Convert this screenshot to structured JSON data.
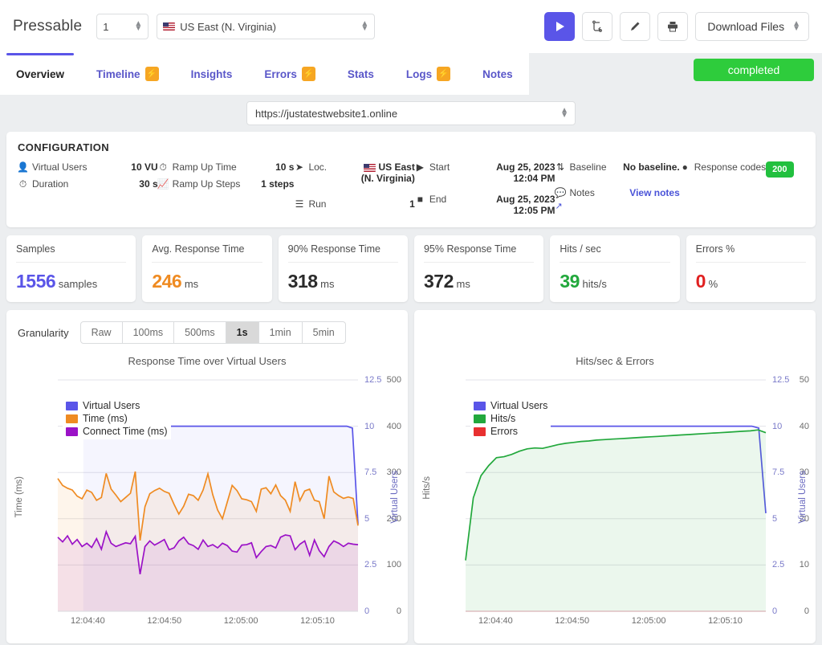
{
  "topbar": {
    "brand": "Pressable",
    "run_number": "1",
    "region": "US East (N. Virginia)",
    "play_icon": "play-icon",
    "compare_icon": "compare-icon",
    "edit_icon": "pencil-icon",
    "print_icon": "printer-icon",
    "download_label": "Download Files"
  },
  "tabs": [
    {
      "label": "Overview",
      "badge": "",
      "active": true
    },
    {
      "label": "Timeline",
      "badge": "⚡",
      "active": false
    },
    {
      "label": "Insights",
      "badge": "",
      "active": false
    },
    {
      "label": "Errors",
      "badge": "⚡",
      "active": false
    },
    {
      "label": "Stats",
      "badge": "",
      "active": false
    },
    {
      "label": "Logs",
      "badge": "⚡",
      "active": false
    },
    {
      "label": "Notes",
      "badge": "",
      "active": false
    }
  ],
  "status": {
    "label": "completed",
    "color": "#2ecc3c"
  },
  "url": {
    "value": "https://justatestwebsite1.online"
  },
  "configuration": {
    "heading": "CONFIGURATION",
    "rows": [
      {
        "label": "Virtual Users",
        "value": "10 VU",
        "icon": "user-icon"
      },
      {
        "label": "Duration",
        "value": "30 s",
        "icon": "clock-icon"
      },
      {
        "label": "Ramp Up Time",
        "value": "10 s",
        "icon": "clock-icon"
      },
      {
        "label": "Ramp Up Steps",
        "value": "1 steps",
        "icon": "chart-line-icon"
      },
      {
        "label": "Loc.",
        "value": "US East (N. Virginia)",
        "icon": "location-icon"
      },
      {
        "label": "Run",
        "value": "1",
        "icon": "list-icon"
      },
      {
        "label": "Start",
        "value": "Aug 25, 2023 12:04 PM",
        "icon": "play-icon"
      },
      {
        "label": "End",
        "value": "Aug 25, 2023 12:05 PM",
        "icon": "stop-icon"
      },
      {
        "label": "Baseline",
        "value": "No baseline.",
        "icon": "baseline-icon"
      },
      {
        "label": "Notes",
        "value": "View notes",
        "icon": "comment-icon"
      },
      {
        "label": "Response codes",
        "value": "200",
        "icon": "circle-icon"
      }
    ]
  },
  "metrics": [
    {
      "title": "Samples",
      "value": "1556",
      "unit": "samples",
      "color": "#5a55e8"
    },
    {
      "title": "Avg. Response Time",
      "value": "246",
      "unit": "ms",
      "color": "#ef8b22"
    },
    {
      "title": "90% Response Time",
      "value": "318",
      "unit": "ms",
      "color": "#2b2b2b"
    },
    {
      "title": "95% Response Time",
      "value": "372",
      "unit": "ms",
      "color": "#2b2b2b"
    },
    {
      "title": "Hits / sec",
      "value": "39",
      "unit": "hits/s",
      "color": "#22a83c"
    },
    {
      "title": "Errors %",
      "value": "0",
      "unit": "%",
      "color": "#e02020"
    }
  ],
  "granularity": {
    "label": "Granularity",
    "options": [
      "Raw",
      "100ms",
      "500ms",
      "1s",
      "1min",
      "5min"
    ],
    "selected": "1s"
  },
  "chart_data": [
    {
      "type": "line",
      "title": "Response Time over Virtual Users",
      "xlabel": "",
      "ylabel": "Time (ms)",
      "y2label": "Virtual Users",
      "ylim": [
        0,
        500
      ],
      "yticks": [
        0,
        100,
        200,
        300,
        400,
        500
      ],
      "y2lim": [
        0,
        12.5
      ],
      "y2ticks": [
        0,
        2.5,
        5,
        7.5,
        10,
        12.5
      ],
      "xticks": [
        "12:04:40",
        "12:04:50",
        "12:05:00",
        "12:05:10"
      ],
      "xtick_positions": [
        0.1,
        0.355,
        0.61,
        0.865
      ],
      "grid": true,
      "legend_position": "top-left",
      "series": [
        {
          "name": "Virtual Users",
          "color": "#5a55e8",
          "axis": "right",
          "values": [
            10,
            10,
            10,
            10,
            10,
            10,
            10,
            10,
            10,
            10,
            10,
            10,
            10,
            10,
            10,
            10,
            10,
            10,
            10,
            10,
            10,
            10,
            10,
            10,
            10,
            10,
            10,
            10,
            10,
            10,
            10,
            10,
            10,
            10,
            10,
            10,
            10,
            10,
            10,
            10,
            10,
            10,
            10,
            10,
            10,
            10,
            10,
            10,
            9.9,
            4.7
          ]
        },
        {
          "name": "Time (ms)",
          "color": "#ef8b22",
          "axis": "left",
          "values": [
            287,
            272,
            266,
            262,
            249,
            243,
            262,
            257,
            240,
            246,
            298,
            264,
            251,
            237,
            246,
            255,
            302,
            153,
            226,
            254,
            261,
            266,
            259,
            255,
            231,
            210,
            227,
            253,
            250,
            240,
            262,
            297,
            252,
            219,
            200,
            236,
            272,
            261,
            243,
            241,
            237,
            216,
            264,
            267,
            254,
            273,
            250,
            240,
            216,
            280,
            239,
            260,
            264,
            240,
            237,
            200,
            292,
            258,
            250,
            244,
            247,
            244,
            185
          ]
        },
        {
          "name": "Connect Time (ms)",
          "color": "#9b12c7",
          "axis": "left",
          "values": [
            160,
            150,
            163,
            145,
            155,
            140,
            147,
            138,
            157,
            134,
            172,
            147,
            140,
            144,
            148,
            146,
            162,
            80,
            140,
            152,
            143,
            149,
            155,
            133,
            137,
            152,
            160,
            146,
            142,
            134,
            154,
            140,
            144,
            137,
            147,
            142,
            130,
            128,
            143,
            144,
            148,
            116,
            129,
            140,
            142,
            137,
            160,
            165,
            163,
            133,
            145,
            152,
            121,
            154,
            131,
            118,
            140,
            152,
            147,
            140,
            147,
            145,
            144
          ]
        }
      ]
    },
    {
      "type": "area",
      "title": "Hits/sec & Errors",
      "xlabel": "",
      "ylabel": "Hits/s",
      "y2label": "Virtual Users",
      "ylim": [
        0,
        50
      ],
      "yticks": [
        0,
        10,
        20,
        30,
        40,
        50
      ],
      "y2lim": [
        0,
        12.5
      ],
      "y2ticks": [
        0,
        2.5,
        5,
        7.5,
        10,
        12.5
      ],
      "xticks": [
        "12:04:40",
        "12:04:50",
        "12:05:00",
        "12:05:10"
      ],
      "xtick_positions": [
        0.1,
        0.355,
        0.61,
        0.865
      ],
      "grid": true,
      "legend_position": "top-left",
      "series": [
        {
          "name": "Virtual Users",
          "color": "#5a55e8",
          "axis": "right",
          "values": [
            10,
            10,
            10,
            10,
            10,
            10,
            10,
            10,
            10,
            10,
            10,
            10,
            10,
            10,
            10,
            10,
            10,
            10,
            10,
            10,
            10,
            10,
            10,
            10,
            10,
            10,
            10,
            10,
            10,
            10,
            10,
            10,
            10,
            10,
            10,
            10,
            10,
            10,
            9.9,
            5.3
          ]
        },
        {
          "name": "Hits/s",
          "color": "#22a83c",
          "axis": "left",
          "values": [
            11.0,
            24.5,
            29.3,
            31.5,
            33.2,
            33.4,
            33.9,
            34.6,
            35.1,
            35.3,
            35.2,
            35.6,
            36.0,
            36.3,
            36.5,
            36.7,
            36.8,
            37.0,
            37.1,
            37.2,
            37.3,
            37.4,
            37.5,
            37.6,
            37.7,
            37.8,
            37.9,
            38.0,
            38.1,
            38.2,
            38.3,
            38.4,
            38.5,
            38.6,
            38.7,
            38.8,
            38.9,
            39.0,
            39.2,
            38.6
          ]
        },
        {
          "name": "Errors",
          "color": "#e83030",
          "axis": "left",
          "values": [
            0,
            0,
            0,
            0,
            0,
            0,
            0,
            0,
            0,
            0,
            0,
            0,
            0,
            0,
            0,
            0,
            0,
            0,
            0,
            0,
            0,
            0,
            0,
            0,
            0,
            0,
            0,
            0,
            0,
            0,
            0,
            0,
            0,
            0,
            0,
            0,
            0,
            0,
            0,
            0
          ]
        }
      ]
    }
  ]
}
